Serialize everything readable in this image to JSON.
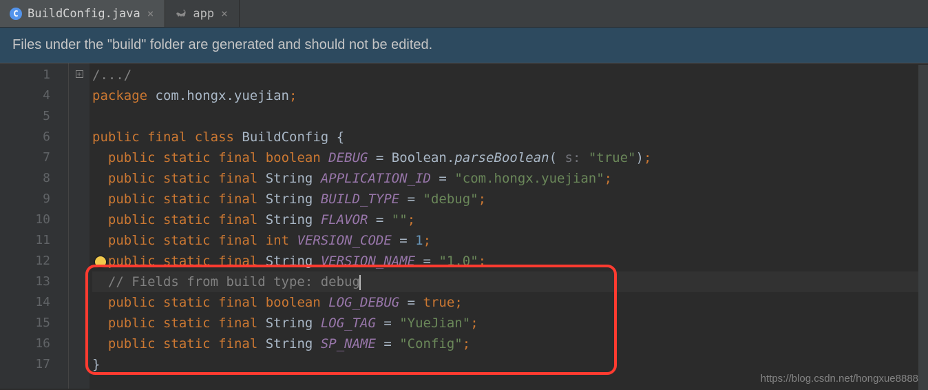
{
  "tabs": [
    {
      "label": "BuildConfig.java",
      "icon": "java",
      "active": true
    },
    {
      "label": "app",
      "icon": "gradle",
      "active": false
    }
  ],
  "warning": "Files under the \"build\" folder are generated and should not be edited.",
  "gutter_lines": [
    "1",
    "4",
    "5",
    "6",
    "7",
    "8",
    "9",
    "10",
    "11",
    "12",
    "13",
    "14",
    "15",
    "16",
    "17"
  ],
  "code": {
    "fold_comment": "/.../",
    "package_kw": "package",
    "package_name": "com.hongx.yuejian",
    "public_kw": "public",
    "static_kw": "static",
    "final_kw": "final",
    "class_kw": "class",
    "boolean_kw": "boolean",
    "int_kw": "int",
    "string_type": "String",
    "class_name": "BuildConfig",
    "debug_field": "DEBUG",
    "boolean_cls": "Boolean",
    "parseBoolean": "parseBoolean",
    "param_s": "s:",
    "true_str": "\"true\"",
    "app_id_field": "APPLICATION_ID",
    "app_id_val": "\"com.hongx.yuejian\"",
    "build_type_field": "BUILD_TYPE",
    "build_type_val": "\"debug\"",
    "flavor_field": "FLAVOR",
    "flavor_val": "\"\"",
    "version_code_field": "VERSION_CODE",
    "version_code_val": "1",
    "version_name_field": "VERSION_NAME",
    "version_name_val": "\"1.0\"",
    "comment_fields": "// Fields from build type: debug",
    "log_debug_field": "LOG_DEBUG",
    "true_kw": "true",
    "log_tag_field": "LOG_TAG",
    "log_tag_val": "\"YueJian\"",
    "sp_name_field": "SP_NAME",
    "sp_name_val": "\"Config\""
  },
  "watermark": "https://blog.csdn.net/hongxue8888"
}
